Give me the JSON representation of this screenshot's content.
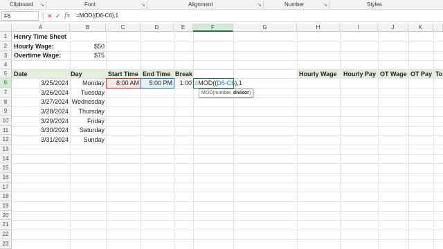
{
  "ribbon": {
    "groups": [
      "Clipboard",
      "Font",
      "Alignment",
      "Number",
      "Styles"
    ]
  },
  "formula_bar": {
    "name_box": "F6",
    "formula": "=MOD((D6-C6),1"
  },
  "columns": [
    "A",
    "B",
    "C",
    "D",
    "E",
    "F",
    "G",
    "H",
    "I",
    "J",
    "K"
  ],
  "rows": [
    "1",
    "2",
    "3",
    "4",
    "5",
    "6",
    "7",
    "8",
    "9",
    "10",
    "11",
    "12",
    "13",
    "14",
    "15",
    "16",
    "17",
    "18",
    "19",
    "20",
    "21",
    "22",
    "23"
  ],
  "sheet": {
    "title": "Henry Time Sheet",
    "hourly_wage_label": "Hourly Wage:",
    "hourly_wage_value": "$50",
    "overtime_wage_label": "Overtime Wage:",
    "overtime_wage_value": "$75",
    "headers": {
      "date": "Date",
      "day": "Day",
      "start_time": "Start Time",
      "end_time": "End Time",
      "break": "Break",
      "hourly_wage": "Hourly Wage",
      "hourly_pay": "Hourly Pay",
      "ot_wage": "OT Wage",
      "ot_pay": "OT Pay",
      "total_cut": "To"
    },
    "entries": [
      {
        "date": "3/25/2024",
        "day": "Monday"
      },
      {
        "date": "3/26/2024",
        "day": "Tuesday"
      },
      {
        "date": "3/27/2024",
        "day": "Wednesday"
      },
      {
        "date": "3/28/2024",
        "day": "Thursday"
      },
      {
        "date": "3/29/2024",
        "day": "Friday"
      },
      {
        "date": "3/30/2024",
        "day": "Saturday"
      },
      {
        "date": "3/31/2024",
        "day": "Sunday"
      }
    ],
    "row6": {
      "start": "8:00 AM",
      "end": "5:00 PM",
      "break": "1:00",
      "edit_prefix": "=MOD((",
      "edit_ref": "D6-C6",
      "edit_suffix": "),1"
    }
  },
  "tooltip": {
    "fn": "MOD(number, ",
    "arg": "divisor",
    "close": ")"
  }
}
